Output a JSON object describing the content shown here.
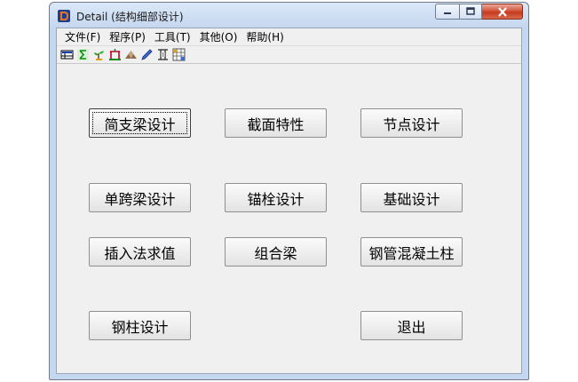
{
  "window": {
    "title": "Detail (结构细部设计)",
    "accent_close": "#c63a1f"
  },
  "menu": [
    {
      "label": "文件(F)"
    },
    {
      "label": "程序(P)"
    },
    {
      "label": "工具(T)"
    },
    {
      "label": "其他(O)"
    },
    {
      "label": "帮助(H)"
    }
  ],
  "toolbar": [
    {
      "icon": "table-icon"
    },
    {
      "icon": "sigma-icon"
    },
    {
      "icon": "plant-icon"
    },
    {
      "icon": "frame-icon"
    },
    {
      "icon": "mountain-icon"
    },
    {
      "icon": "pencil-icon"
    },
    {
      "icon": "column-icon"
    },
    {
      "icon": "grid-icon"
    }
  ],
  "buttons": {
    "simple_beam": "简支梁设计",
    "section_props": "截面特性",
    "joint_design": "节点设计",
    "single_span": "单跨梁设计",
    "anchor_bolt": "锚栓设计",
    "foundation": "基础设计",
    "interpolation": "插入法求值",
    "composite_beam": "组合梁",
    "cfst_column": "钢管混凝土柱",
    "steel_column": "钢柱设计",
    "exit": "退出"
  }
}
